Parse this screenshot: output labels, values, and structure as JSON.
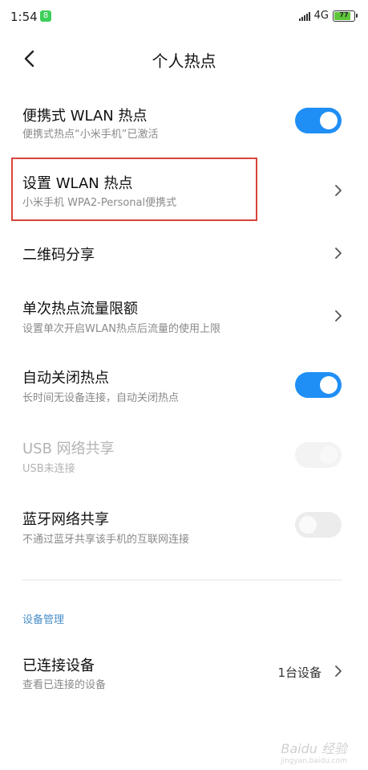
{
  "status_bar": {
    "time": "1:54",
    "notification_badge": "8",
    "network": "4G",
    "battery": "77"
  },
  "header": {
    "title": "个人热点"
  },
  "settings": [
    {
      "title": "便携式 WLAN 热点",
      "subtitle": "便携式热点“小米手机”已激活",
      "control": "toggle",
      "state": "on"
    },
    {
      "title": "设置 WLAN 热点",
      "subtitle": "小米手机 WPA2-Personal便携式",
      "control": "chevron"
    },
    {
      "title": "二维码分享",
      "control": "chevron"
    },
    {
      "title": "单次热点流量限额",
      "subtitle": "设置单次开启WLAN热点后流量的使用上限",
      "control": "chevron"
    },
    {
      "title": "自动关闭热点",
      "subtitle": "长时间无设备连接，自动关闭热点",
      "control": "toggle",
      "state": "on"
    },
    {
      "title": "USB 网络共享",
      "subtitle": "USB未连接",
      "control": "toggle",
      "state": "disabled"
    },
    {
      "title": "蓝牙网络共享",
      "subtitle": "不通过蓝牙共享该手机的互联网连接",
      "control": "toggle",
      "state": "off"
    }
  ],
  "device_section": {
    "label": "设备管理",
    "connected": {
      "title": "已连接设备",
      "subtitle": "查看已连接的设备",
      "value": "1台设备"
    }
  },
  "watermark": {
    "text": "Baidu 经验",
    "url": "jingyan.baidu.com"
  },
  "colors": {
    "accent": "#1f8ff5",
    "highlight": "#d9443a",
    "section_label": "#4a8fc9"
  }
}
